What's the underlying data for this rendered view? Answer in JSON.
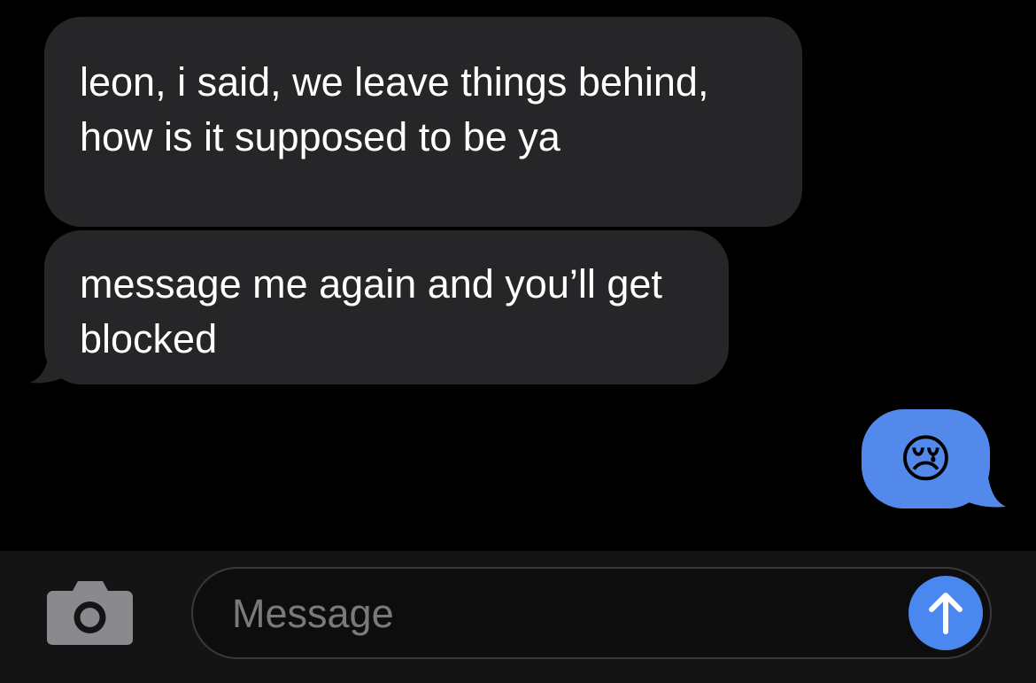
{
  "conversation": {
    "received": [
      {
        "text": "leon, i said, we leave things behind, how is it supposed to be ya"
      },
      {
        "text": "message me again and you’ll get blocked"
      }
    ],
    "sent": [
      {
        "emoji": "😢",
        "icon": "crying-face-emoji"
      }
    ]
  },
  "composer": {
    "camera_icon": "camera-icon",
    "placeholder": "Message",
    "send_icon": "arrow-up-icon"
  },
  "colors": {
    "background": "#000000",
    "received_bubble": "#262628",
    "sent_bubble": "#5389ea",
    "send_button": "#4a87ee",
    "composer_bar": "#141414",
    "placeholder_text": "#7a7a7e"
  }
}
